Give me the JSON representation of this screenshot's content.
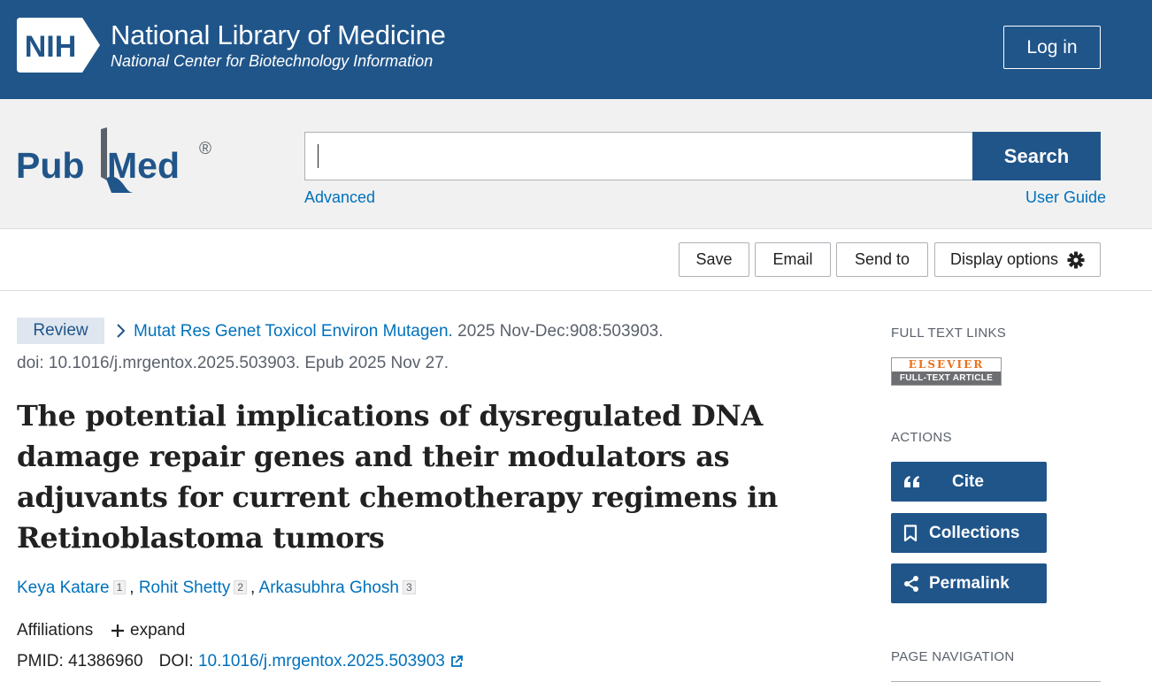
{
  "header": {
    "nih_logo_text": "NIH",
    "title": "National Library of Medicine",
    "subtitle": "National Center for Biotechnology Information",
    "login_label": "Log in"
  },
  "search": {
    "logo_text_left": "Pub",
    "logo_text_right": "Med",
    "logo_mark": "®",
    "value": "",
    "button_label": "Search",
    "advanced_label": "Advanced",
    "user_guide_label": "User Guide"
  },
  "toolbar": {
    "save_label": "Save",
    "email_label": "Email",
    "send_to_label": "Send to",
    "display_options_label": "Display options"
  },
  "article": {
    "type_badge": "Review",
    "journal": "Mutat Res Genet Toxicol Environ Mutagen.",
    "citation_rest": " 2025 Nov-Dec:908:503903.",
    "doi_line": "doi: 10.1016/j.mrgentox.2025.503903. Epub 2025 Nov 27.",
    "title": "The potential implications of dysregulated DNA damage repair genes and their modulators as adjuvants for current chemotherapy regimens in Retinoblastoma tumors",
    "authors": [
      {
        "name": "Keya Katare",
        "aff": "1"
      },
      {
        "name": "Rohit Shetty",
        "aff": "2"
      },
      {
        "name": "Arkasubhra Ghosh",
        "aff": "3"
      }
    ],
    "affiliations_label": "Affiliations",
    "expand_label": "expand",
    "pmid_label": "PMID:",
    "pmid": "41386960",
    "doi_label": "DOI:",
    "doi": "10.1016/j.mrgentox.2025.503903"
  },
  "sidebar": {
    "full_text_links_heading": "FULL TEXT LINKS",
    "elsevier_top": "ELSEVIER",
    "elsevier_bottom": "FULL-TEXT ARTICLE",
    "actions_heading": "ACTIONS",
    "cite_label": "Cite",
    "collections_label": "Collections",
    "permalink_label": "Permalink",
    "page_navigation_heading": "PAGE NAVIGATION"
  },
  "colors": {
    "brand_blue": "#20558a",
    "link_blue": "#0071bc",
    "band_gray": "#f1f1f1",
    "badge_bg": "#dfe6ef",
    "elsevier_orange": "#e9711c"
  },
  "icons": [
    "chevron-right-icon",
    "gear-icon",
    "plus-icon",
    "external-link-icon",
    "quote-icon",
    "bookmark-icon",
    "share-icon"
  ]
}
